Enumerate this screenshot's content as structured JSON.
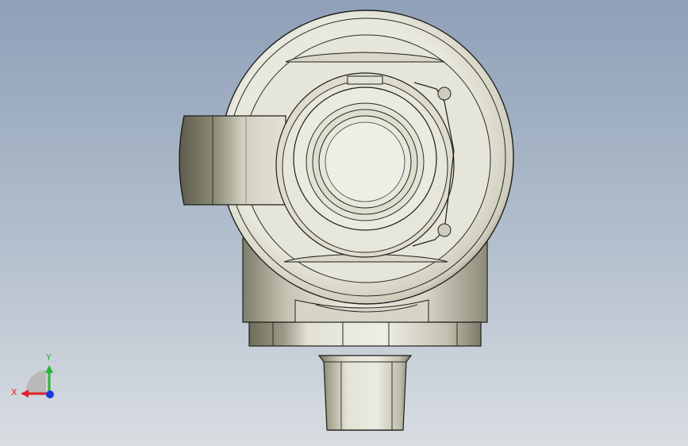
{
  "triad": {
    "x_label": "X",
    "y_label": "Y"
  },
  "colors": {
    "background_top": "#8fa0b8",
    "background_bottom": "#d9dde2",
    "metal_light": "#e8e7dc",
    "metal_mid": "#c9c8b8",
    "metal_dark": "#6b6a58",
    "edge": "#1e1e1a",
    "axis_x": "#e0222a",
    "axis_y": "#2bb33a",
    "axis_z": "#1a3ad8"
  }
}
